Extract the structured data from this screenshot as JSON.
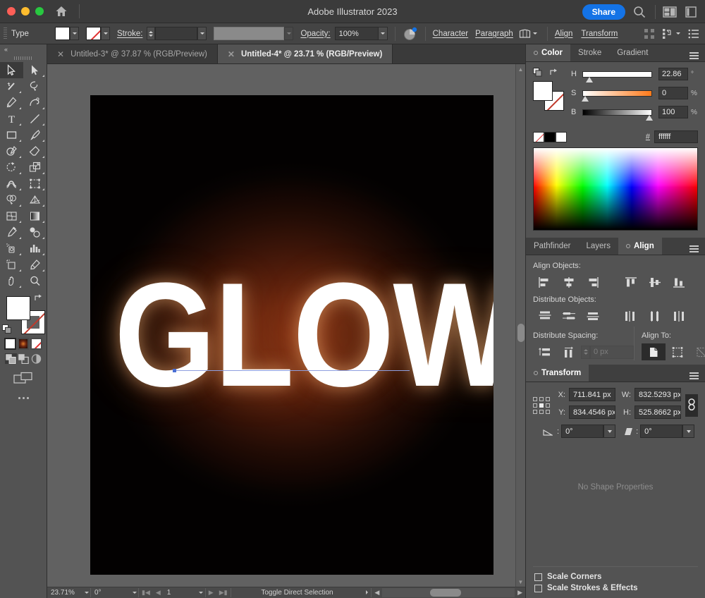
{
  "titlebar": {
    "app_title": "Adobe Illustrator 2023",
    "share_label": "Share",
    "icons": [
      "home-icon",
      "search-icon",
      "arrange-layout-icon",
      "panel-layout-icon"
    ]
  },
  "controlbar": {
    "selection_type_label": "Type",
    "fill_swatch": "white",
    "stroke_label": "Stroke:",
    "stroke_weight": "",
    "opacity_label": "Opacity:",
    "opacity_value": "100%",
    "character_label": "Character",
    "paragraph_label": "Paragraph",
    "align_label": "Align",
    "transform_label": "Transform"
  },
  "toolbar": {
    "collapse_label": "«",
    "tools": [
      {
        "name": "selection-tool",
        "selected": true
      },
      {
        "name": "direct-selection-tool",
        "selected": false
      },
      {
        "name": "magic-wand-tool",
        "selected": false
      },
      {
        "name": "lasso-tool",
        "selected": false
      },
      {
        "name": "pen-tool",
        "selected": false
      },
      {
        "name": "curvature-tool",
        "selected": false
      },
      {
        "name": "type-tool",
        "selected": false
      },
      {
        "name": "line-segment-tool",
        "selected": false
      },
      {
        "name": "rectangle-tool",
        "selected": false
      },
      {
        "name": "paintbrush-tool",
        "selected": false
      },
      {
        "name": "shaper-tool",
        "selected": false
      },
      {
        "name": "eraser-tool",
        "selected": false
      },
      {
        "name": "rotate-tool",
        "selected": false
      },
      {
        "name": "scale-tool",
        "selected": false
      },
      {
        "name": "width-tool",
        "selected": false
      },
      {
        "name": "free-transform-tool",
        "selected": false
      },
      {
        "name": "shape-builder-tool",
        "selected": false
      },
      {
        "name": "perspective-grid-tool",
        "selected": false
      },
      {
        "name": "mesh-tool",
        "selected": false
      },
      {
        "name": "gradient-tool",
        "selected": false
      },
      {
        "name": "eyedropper-tool",
        "selected": false
      },
      {
        "name": "blend-tool",
        "selected": false
      },
      {
        "name": "symbol-sprayer-tool",
        "selected": false
      },
      {
        "name": "column-graph-tool",
        "selected": false
      },
      {
        "name": "artboard-tool",
        "selected": false
      },
      {
        "name": "slice-tool",
        "selected": false
      },
      {
        "name": "hand-tool",
        "selected": false
      },
      {
        "name": "zoom-tool",
        "selected": false
      }
    ],
    "fill_color": "#ffffff",
    "stroke_color": "none",
    "quick_swatches": [
      "white",
      "gradient",
      "none"
    ],
    "draw_modes": [
      "draw-normal",
      "draw-behind",
      "draw-inside"
    ],
    "screen_mode": "change-screen-mode",
    "more_tools": "edit-toolbar"
  },
  "doctabs": [
    {
      "title": "Untitled-3* @ 37.87 % (RGB/Preview)",
      "active": false
    },
    {
      "title": "Untitled-4* @ 23.71 % (RGB/Preview)",
      "active": true
    }
  ],
  "canvas": {
    "artwork_text": "GLOW",
    "artwork_fill": "#ffffff",
    "background_glow_color": "#7a2d12",
    "background_edge_color": "#050505"
  },
  "statusbar": {
    "zoom_value": "23.71%",
    "rotation_value": "0°",
    "artboard_number": "1",
    "status_text": "Toggle Direct Selection"
  },
  "color_panel": {
    "tabs": [
      {
        "label": "Color",
        "active": true
      },
      {
        "label": "Stroke",
        "active": false
      },
      {
        "label": "Gradient",
        "active": false
      }
    ],
    "sliders": [
      {
        "label": "H",
        "value": "22.86",
        "unit": "°",
        "knob_pct": 5
      },
      {
        "label": "S",
        "value": "0",
        "unit": "%",
        "knob_pct": 0
      },
      {
        "label": "B",
        "value": "100",
        "unit": "%",
        "knob_pct": 100
      }
    ],
    "hex_label": "#",
    "hex_value": "ffffff",
    "tiny_swatches": [
      "none",
      "black",
      "white"
    ]
  },
  "align_panel": {
    "tabs": [
      {
        "label": "Pathfinder",
        "active": false
      },
      {
        "label": "Layers",
        "active": false
      },
      {
        "label": "Align",
        "active": true
      }
    ],
    "align_objects_label": "Align Objects:",
    "align_objects_icons": [
      "align-left-icon",
      "align-horizontal-center-icon",
      "align-right-icon",
      "align-top-icon",
      "align-vertical-center-icon",
      "align-bottom-icon"
    ],
    "distribute_objects_label": "Distribute Objects:",
    "distribute_objects_icons": [
      "distribute-top-icon",
      "distribute-vertical-center-icon",
      "distribute-bottom-icon",
      "distribute-left-icon",
      "distribute-horizontal-center-icon",
      "distribute-right-icon"
    ],
    "distribute_spacing_label": "Distribute Spacing:",
    "distribute_spacing_icons": [
      "vertical-distribute-space-icon",
      "horizontal-distribute-space-icon"
    ],
    "spacing_value": "0 px",
    "align_to_label": "Align To:",
    "align_to_icons": [
      "align-to-selection-icon",
      "align-to-artboard-icon",
      "align-to-key-object-icon"
    ]
  },
  "transform_panel": {
    "title": "Transform",
    "x_label": "X:",
    "x_value": "711.841 px",
    "y_label": "Y:",
    "y_value": "834.4546 px",
    "w_label": "W:",
    "w_value": "832.5293 px",
    "h_label": "H:",
    "h_value": "525.8662 px",
    "link_icon": "link-wh-icon",
    "angle_label": "angle-icon",
    "angle_value": "0°",
    "shear_label": "shear-icon",
    "shear_value": "0°",
    "no_shape_text": "No Shape Properties",
    "scale_corners_label": "Scale Corners",
    "scale_strokes_label": "Scale Strokes & Effects"
  }
}
